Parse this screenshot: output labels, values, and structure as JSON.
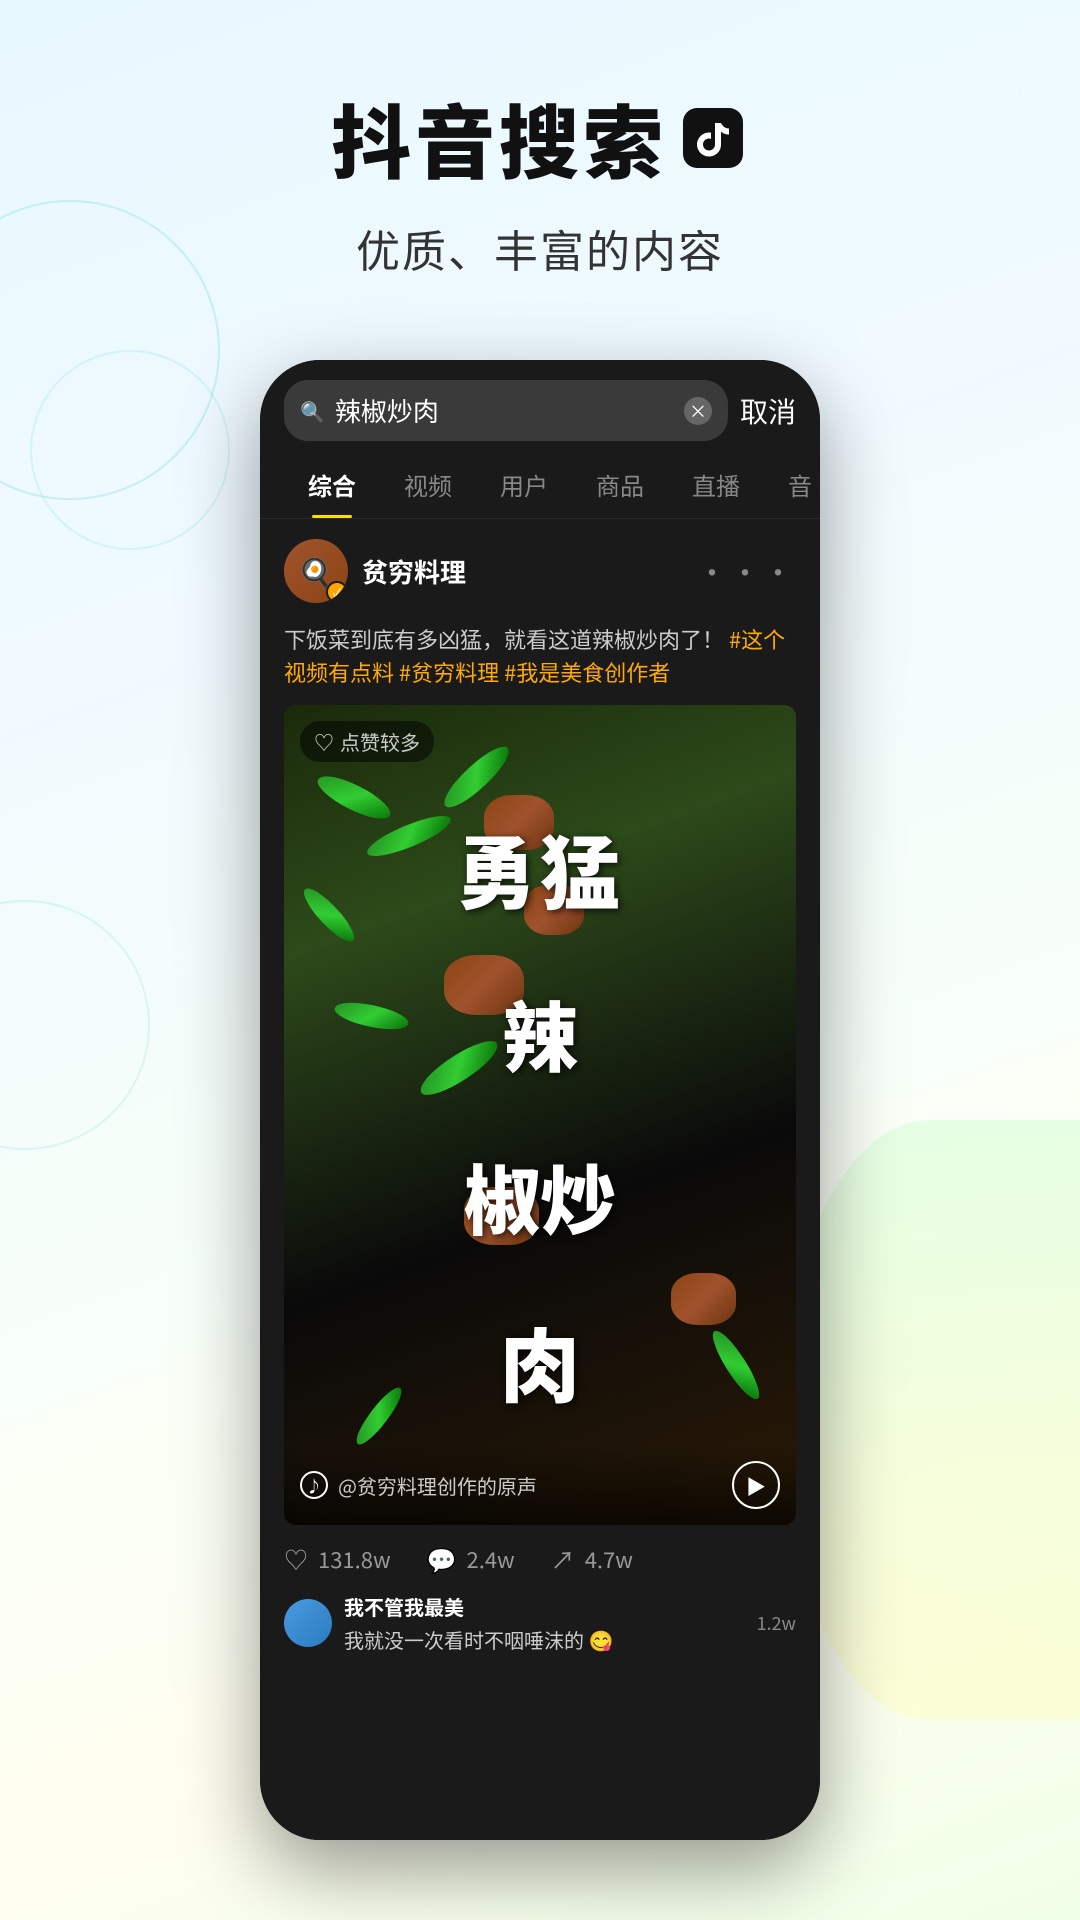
{
  "header": {
    "main_title": "抖音搜索",
    "subtitle": "优质、丰富的内容"
  },
  "search": {
    "query": "辣椒炒肉",
    "cancel_label": "取消"
  },
  "tabs": [
    {
      "label": "综合",
      "active": true
    },
    {
      "label": "视频",
      "active": false
    },
    {
      "label": "用户",
      "active": false
    },
    {
      "label": "商品",
      "active": false
    },
    {
      "label": "直播",
      "active": false
    },
    {
      "label": "音",
      "active": false
    }
  ],
  "post": {
    "username": "贫穷料理",
    "verified": true,
    "description": "下饭菜到底有多凶猛，就看这道辣椒炒肉了！",
    "tags": "#这个视频有点料 #贫穷料理 #我是美食创作者",
    "likes_badge": "点赞较多",
    "video_title": "勇猛\n辣\n椒炒\n肉",
    "video_source": "@贫穷料理创作的原声",
    "stats": {
      "likes": "131.8w",
      "comments": "2.4w",
      "shares": "4.7w"
    }
  },
  "comments": [
    {
      "author": "我不管我最美",
      "text": "我就没一次看时不咽唾沫的 😋",
      "likes": "1.2w"
    }
  ]
}
